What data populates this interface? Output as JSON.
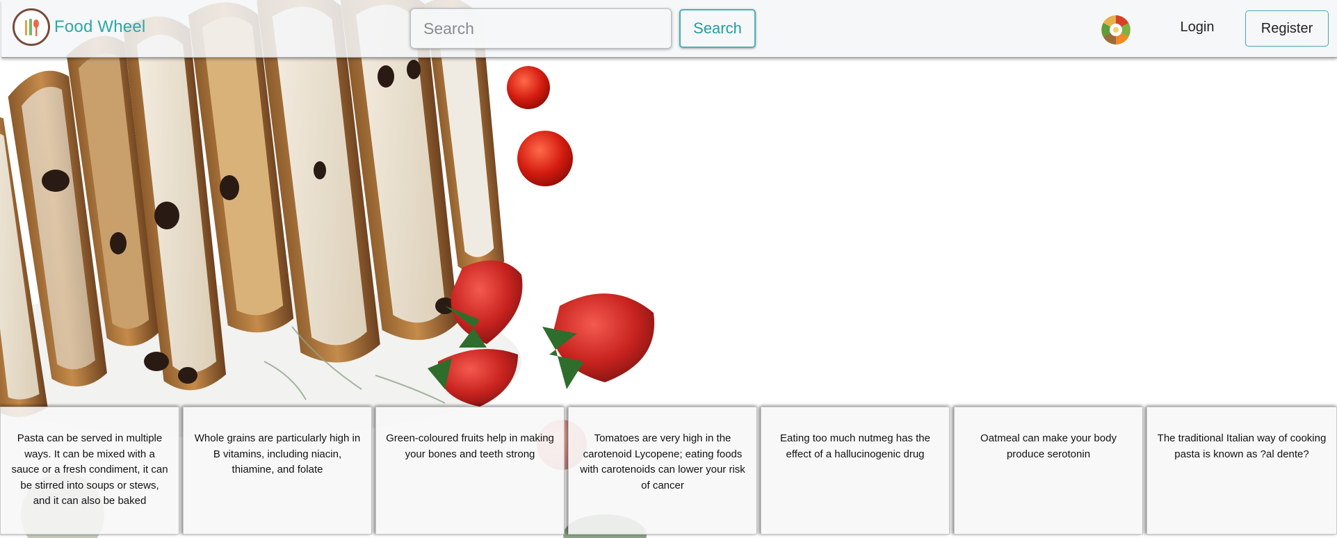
{
  "navbar": {
    "brand_name": "Food Wheel",
    "logo_icon": "cutlery-logo-icon",
    "search_placeholder": "Search",
    "search_button_label": "Search",
    "wheel_icon": "food-wheel-icon",
    "login_label": "Login",
    "register_label": "Register",
    "brand_color": "#2aa9a7",
    "accent_color": "#47b3b6"
  },
  "facts": [
    "Pasta can be served in multiple ways. It can be mixed with a sauce or a fresh condiment, it can be stirred into soups or stews, and it can also be baked",
    "Whole grains are particularly high in B vitamins, including niacin, thiamine, and folate",
    "Green-coloured fruits help in making your bones and teeth strong",
    "Tomatoes are very high in the carotenoid Lycopene; eating foods with carotenoids can lower your risk of cancer",
    "Eating too much nutmeg has the effect of a hallucinogenic drug",
    "Oatmeal can make your body produce serotonin",
    "The traditional Italian way of cooking pasta is known as ?al dente?"
  ]
}
